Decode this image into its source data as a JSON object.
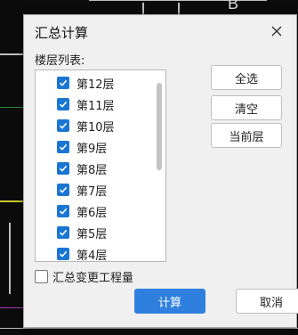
{
  "background": {
    "cad_text": "B",
    "colors": {
      "canvas": "#0b0b0b",
      "line_white": "#bdbdbd",
      "line_green": "#2e8b2e",
      "line_yellow": "#c8c830",
      "line_magenta": "#b03ab0"
    }
  },
  "dialog": {
    "title": "汇总计算",
    "close_icon": "close-icon",
    "list_label": "楼层列表:",
    "floors": [
      {
        "label": "第12层",
        "checked": true
      },
      {
        "label": "第11层",
        "checked": true
      },
      {
        "label": "第10层",
        "checked": true
      },
      {
        "label": "第9层",
        "checked": true
      },
      {
        "label": "第8层",
        "checked": true
      },
      {
        "label": "第7层",
        "checked": true
      },
      {
        "label": "第6层",
        "checked": true
      },
      {
        "label": "第5层",
        "checked": true
      },
      {
        "label": "第4层",
        "checked": true
      }
    ],
    "buttons": {
      "select_all": "全选",
      "clear": "清空",
      "current_floor": "当前层",
      "ok": "计算",
      "cancel": "取消"
    },
    "summary_checkbox": {
      "label": "汇总变更工程量",
      "checked": false
    },
    "colors": {
      "accent": "#2f80de",
      "checkbox": "#1976d2",
      "dialog_bg": "#f0f0f0"
    }
  }
}
